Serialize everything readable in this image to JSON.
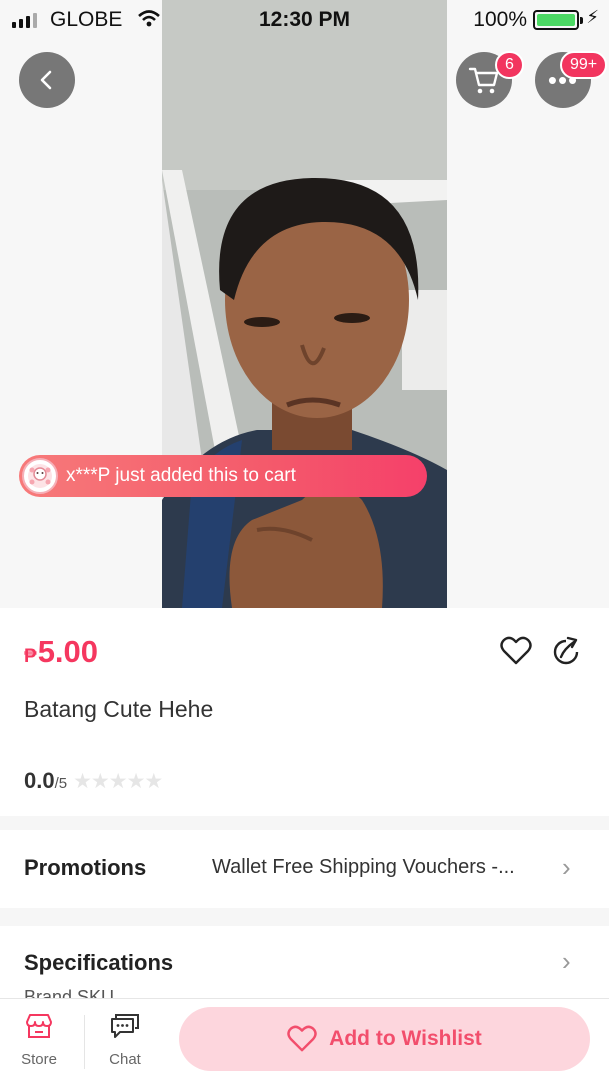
{
  "status_bar": {
    "carrier": "GLOBE",
    "time": "12:30 PM",
    "battery": "100%",
    "battery_level": 1.0
  },
  "header": {
    "back_icon": "chevron-left-icon",
    "cart_icon": "cart-icon",
    "cart_badge": "6",
    "more_icon": "more-dots-icon",
    "more_badge": "99+"
  },
  "toast": {
    "text": "x***P just added this to cart"
  },
  "product": {
    "currency": "₱",
    "price": "5.00",
    "title": "Batang Cute Hehe",
    "rating": "0.0",
    "rating_max": "/5",
    "stars_filled": 0,
    "stars_total": 5
  },
  "promotions": {
    "label": "Promotions",
    "value": "Wallet Free Shipping Vouchers -..."
  },
  "specifications": {
    "label": "Specifications",
    "sub": "Brand SKU"
  },
  "bottom_bar": {
    "store_label": "Store",
    "chat_label": "Chat",
    "wishlist_label": "Add to Wishlist"
  },
  "colors": {
    "accent": "#f5375f",
    "wishlist_bg": "#fdd6dd",
    "toast": "#f45a6b"
  }
}
